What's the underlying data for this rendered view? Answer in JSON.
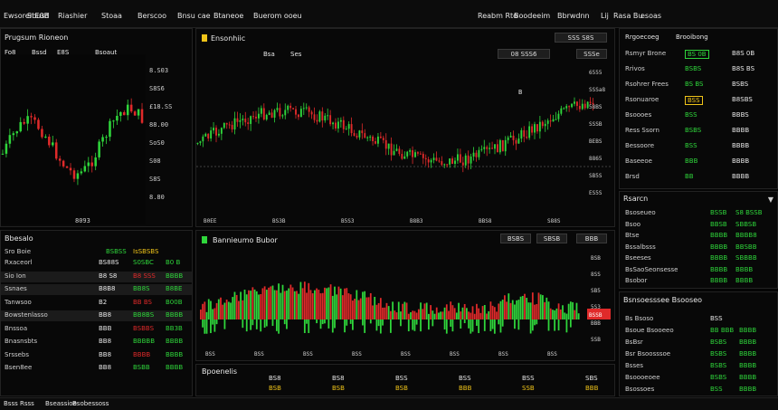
{
  "topbar": {
    "items": [
      "Ewsorer E0B",
      "Sbusd",
      "Riashier",
      "Stoaa",
      "Berscoo",
      "Bnsu cae",
      "Btaneoe",
      "Buerom ooeu"
    ],
    "right": [
      "Reabm Rto",
      "Boodeeim",
      "Bbrwdnn",
      "Lij",
      "Rasa Bu",
      "esoas"
    ]
  },
  "left_panel": {
    "title": "Prugsum Rioneon",
    "tabs": [
      "Fo8",
      "Bssd",
      "E8S",
      "Bsoaut"
    ],
    "price_labels": [
      "8.S03",
      "S8S6",
      "£18.SS",
      "88.00",
      "SoS0",
      "S08",
      "S8S",
      "8.80"
    ],
    "axis_label": "8093"
  },
  "main_chart": {
    "title": "Ensonhiic",
    "tabs": [
      "Bsa",
      "Ses"
    ],
    "buttons": [
      "SSS S8S",
      "SSSe"
    ],
    "toolbar_btn": "08 SSS6",
    "price_labels": [
      "6555",
      "SSSa8",
      "58BS",
      "SSSB",
      "BEBS",
      "8865",
      "SB5S",
      "ES5S"
    ],
    "time_labels": [
      "B0EE",
      "BS3B",
      "B5S3",
      "B8B3",
      "BBS8",
      "S88S"
    ],
    "marker": "B"
  },
  "volume_chart": {
    "title": "Bannieumo Bubor",
    "buttons": [
      "BSBS",
      "SBSB",
      "BBB"
    ],
    "price_labels": [
      "BSB",
      "8SS",
      "SB5",
      "5S3",
      "BBB",
      "SSB"
    ],
    "last_label": "BSSB",
    "time_labels": [
      "BSS",
      "BSS",
      "BSS",
      "BSS",
      "BSS",
      "BSS",
      "BSS",
      "BSS"
    ]
  },
  "order_book": {
    "title": "Bbesalo",
    "header": [
      "Sro Boie",
      "BSBSS",
      "IsSBSBS"
    ],
    "rows": [
      {
        "name": "Rxaceorl",
        "c1": "BS88S",
        "c2": "S0SBC",
        "c3": "B0 B"
      },
      {
        "name": "Sio Ion",
        "c1": "B8 S8",
        "c2": "B8 SSS",
        "c3": "BBBB"
      },
      {
        "name": "Ssnaes",
        "c1": "B8B8",
        "c2": "BB8S",
        "c3": "B8BE"
      },
      {
        "name": "Tanwsoo",
        "c1": "B2",
        "c2": "BB BS",
        "c3": "B00B"
      },
      {
        "name": "Bowstenlasso",
        "c1": "BB8",
        "c2": "BB8BS",
        "c3": "BBBB"
      },
      {
        "name": "Bnssoa",
        "c1": "BBB",
        "c2": "BSBBS",
        "c3": "BB3B"
      },
      {
        "name": "Bnasnsbts",
        "c1": "BB8",
        "c2": "BBBBB",
        "c3": "BBBB"
      },
      {
        "name": "Srssebs",
        "c1": "BB8",
        "c2": "BBBB",
        "c3": "BBBB"
      },
      {
        "name": "Bsen8ee",
        "c1": "BB8",
        "c2": "BSBB",
        "c3": "BBBB"
      }
    ]
  },
  "trade_history": {
    "title": "Bpoenelis",
    "rows": [
      [
        "BS8",
        "BS8",
        "BSS",
        "BSS",
        "BSS",
        "SBS"
      ],
      [
        "BSB",
        "BSB",
        "BSB",
        "BBB",
        "SSB",
        "BBB"
      ]
    ]
  },
  "right_ticker": {
    "header": [
      "Rrgoecoeg",
      "Brooibong"
    ],
    "rows": [
      {
        "name": "Rsmyr Brone",
        "v1": "BS 0B",
        "v2": "B8S 0B"
      },
      {
        "name": "Rrivos",
        "v1": "BSBS",
        "v2": "B8S BS"
      },
      {
        "name": "Rsohrer Frees",
        "v1": "BS BS",
        "v2": "BSBS"
      },
      {
        "name": "Rsonuaroe",
        "v1": "BSS",
        "v2": "B8SBS"
      },
      {
        "name": "Bsoooes",
        "v1": "BSS",
        "v2": "BBBS"
      },
      {
        "name": "Ress Ssorn",
        "v1": "BSBS",
        "v2": "BBBB"
      },
      {
        "name": "Bessoore",
        "v1": "BSS",
        "v2": "BBBB"
      },
      {
        "name": "Baseeoe",
        "v1": "BBB",
        "v2": "BBBB"
      },
      {
        "name": "Brsd",
        "v1": "BB",
        "v2": "BBBB"
      }
    ]
  },
  "right_market": {
    "title": "Rsarcn",
    "rows": [
      {
        "name": "Bsoseueo",
        "v1": "BSSB",
        "v2": "S8 BSSB"
      },
      {
        "name": "Bsoo",
        "v1": "BBSB",
        "v2": "SBBSB"
      },
      {
        "name": "Btse",
        "v1": "BBBB",
        "v2": "BBBB8"
      },
      {
        "name": "Bssalbsss",
        "v1": "BBBB",
        "v2": "BBSBB"
      },
      {
        "name": "Bseeses",
        "v1": "BBBB",
        "v2": "SBBBB"
      },
      {
        "name": "BsSaoSeonsesse",
        "v1": "BBBB",
        "v2": "BBBB"
      },
      {
        "name": "Bsobor",
        "v1": "BBBB",
        "v2": "BBBB"
      }
    ]
  },
  "right_positions": {
    "title": "Bsnsoesssee Bsooseo",
    "rows": [
      {
        "name": "Bs Bsoso",
        "v1": "BSS",
        "v2": ""
      },
      {
        "name": "Bsoue Bsooeeo",
        "v1": "BB BBB",
        "v2": "BBBB"
      },
      {
        "name": "BsBsr",
        "v1": "BSBS",
        "v2": "BBBB"
      },
      {
        "name": "Bsr Bsoosssoe",
        "v1": "BSBS",
        "v2": "BBBB"
      },
      {
        "name": "Bsses",
        "v1": "BSBS",
        "v2": "BBBB"
      },
      {
        "name": "Bsoooeoee",
        "v1": "BSBS",
        "v2": "BBBB"
      },
      {
        "name": "Bsossoes",
        "v1": "BSS",
        "v2": "BBBB"
      }
    ]
  },
  "footer": {
    "items": [
      "Bsss",
      "Rsss",
      "Bseassioe",
      "Bsobessoss"
    ]
  },
  "colors": {
    "up": "#2fd63b",
    "down": "#e02a2a",
    "accent": "#f0c419"
  }
}
